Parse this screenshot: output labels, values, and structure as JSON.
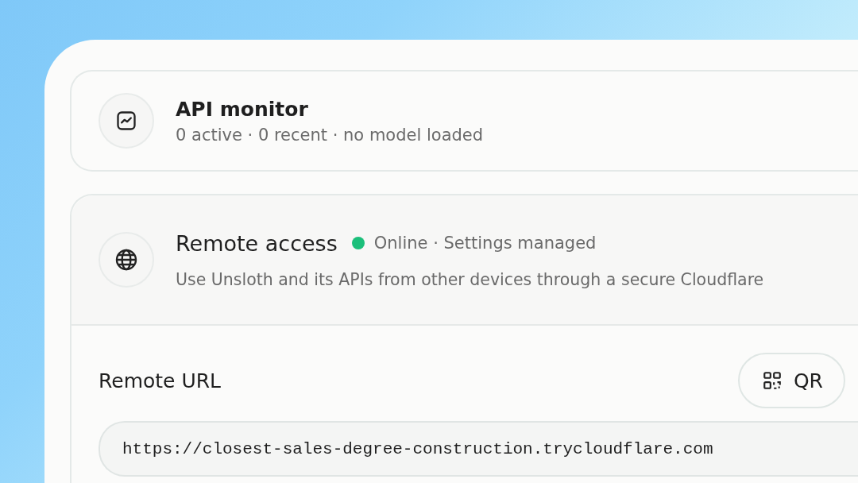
{
  "api_monitor": {
    "title": "API monitor",
    "summary": "0 active · 0 recent · no model loaded"
  },
  "remote_access": {
    "title": "Remote access",
    "status": {
      "online": true,
      "label": "Online · Settings managed"
    },
    "description": "Use Unsloth and its APIs from other devices through a secure Cloudflare",
    "remote_url": {
      "label": "Remote URL",
      "qr_button": "QR",
      "value": "https://closest-sales-degree-construction.trycloudflare.com"
    }
  }
}
